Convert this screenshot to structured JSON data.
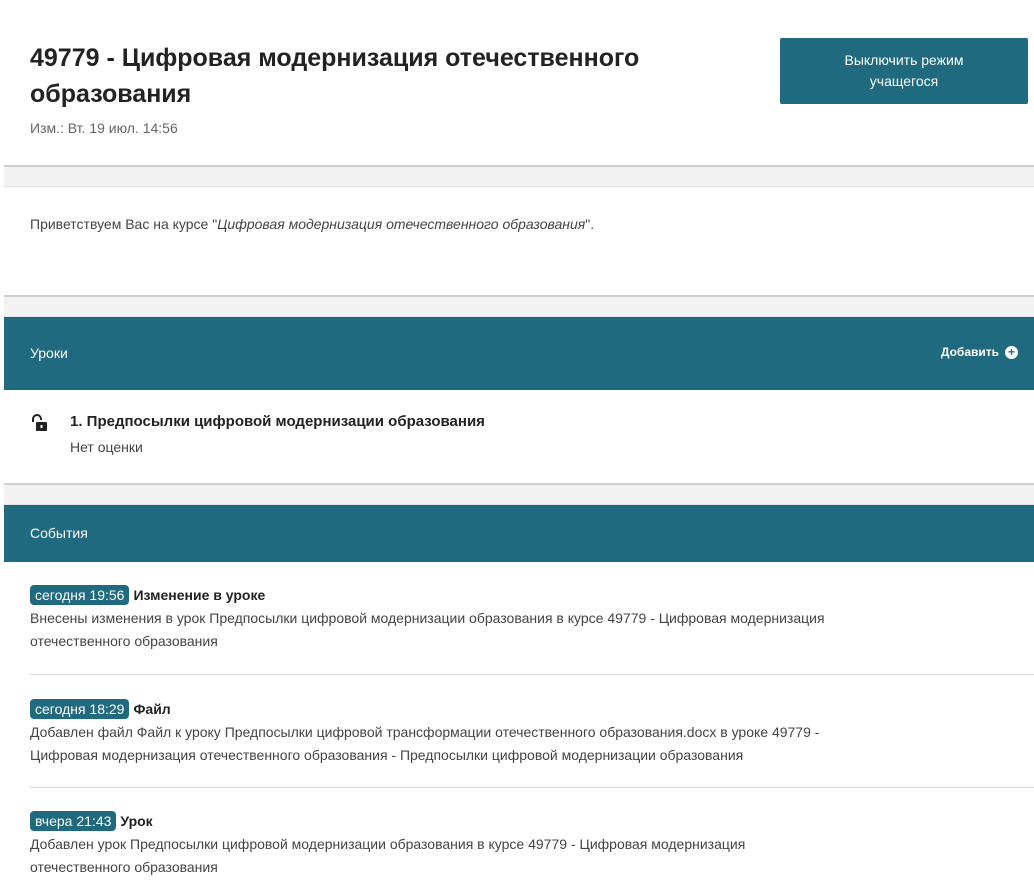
{
  "header": {
    "course_title": "49779 - Цифровая модернизация отечественного образования",
    "modified": "Изм.: Вт. 19 июл. 14:56",
    "student_mode_button": "Выключить режим учащегося"
  },
  "welcome": {
    "prefix": "Приветствуем Вас на курсе \"",
    "course_name": "Цифровая модернизация отечественного образования",
    "suffix": "\"."
  },
  "lessons": {
    "title": "Уроки",
    "add_label": "Добавить",
    "add_icon": "plus-circle-icon",
    "items": [
      {
        "icon": "unlocked-lock-icon",
        "title": "1. Предпосылки цифровой модернизации образования",
        "grade": "Нет оценки"
      }
    ]
  },
  "events": {
    "title": "События",
    "items": [
      {
        "time": "сегодня 19:56",
        "type": "Изменение в уроке",
        "line1": "Внесены изменения в урок Предпосылки цифровой модернизации образования в курсе 49779 - Цифровая модернизация",
        "line2": "отечественного образования"
      },
      {
        "time": "сегодня 18:29",
        "type": "Файл",
        "line1": "Добавлен файл Файл к уроку Предпосылки цифровой трансформации отечественного образования.docx в уроке 49779 -",
        "line2": "Цифровая модернизация отечественного образования - Предпосылки цифровой модернизации образования"
      },
      {
        "time": "вчера 21:43",
        "type": "Урок",
        "line1": "Добавлен урок Предпосылки цифровой модернизации образования в курсе 49779 - Цифровая модернизация",
        "line2": "отечественного образования"
      }
    ]
  },
  "colors": {
    "accent": "#1f6a7f"
  }
}
